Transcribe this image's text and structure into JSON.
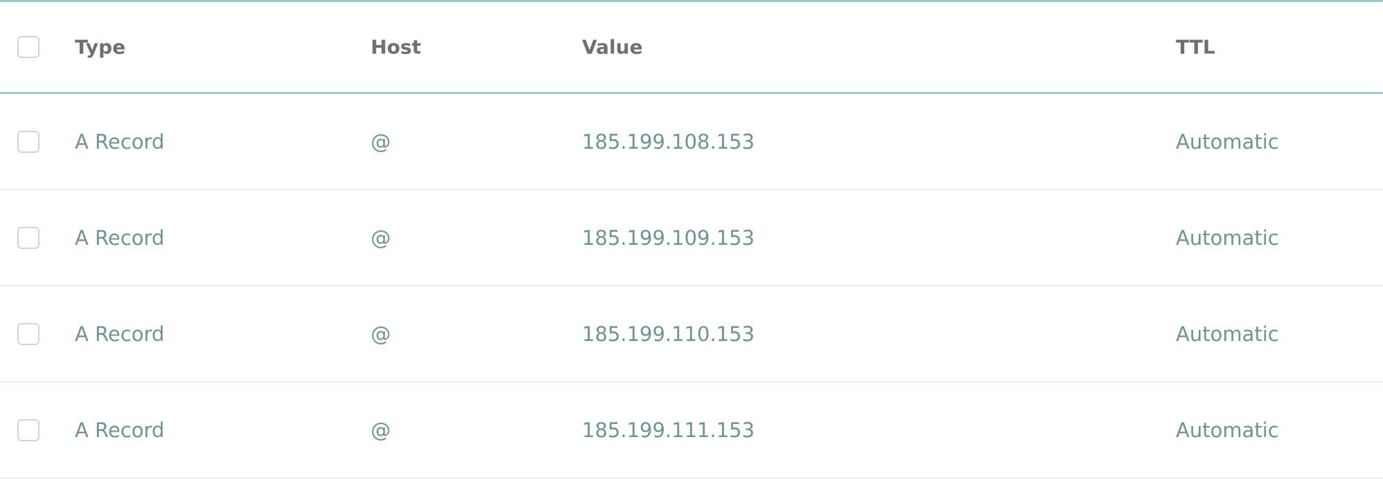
{
  "table": {
    "headers": {
      "type": "Type",
      "host": "Host",
      "value": "Value",
      "ttl": "TTL"
    },
    "rows": [
      {
        "type": "A Record",
        "host": "@",
        "value": "185.199.108.153",
        "ttl": "Automatic"
      },
      {
        "type": "A Record",
        "host": "@",
        "value": "185.199.109.153",
        "ttl": "Automatic"
      },
      {
        "type": "A Record",
        "host": "@",
        "value": "185.199.110.153",
        "ttl": "Automatic"
      },
      {
        "type": "A Record",
        "host": "@",
        "value": "185.199.111.153",
        "ttl": "Automatic"
      }
    ]
  },
  "colors": {
    "header_border": "#9ec8c6",
    "row_divider": "#ececec",
    "header_text": "#707070",
    "data_text": "#6e9593",
    "checkbox_border": "#d4d4d4"
  }
}
